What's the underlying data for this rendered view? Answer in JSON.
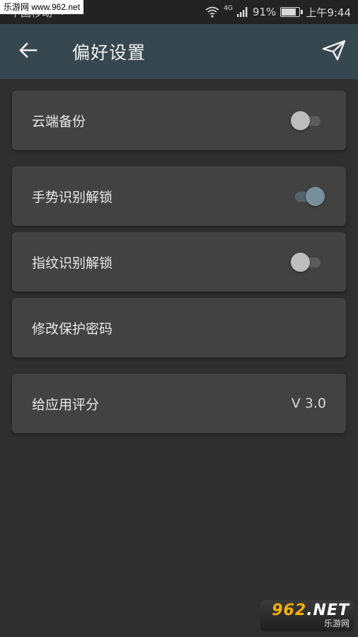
{
  "watermark": {
    "top_text": "乐游网 www.962.net",
    "bottom_number": "962",
    "bottom_suffix": ".NET",
    "bottom_subtitle": "乐游网"
  },
  "status_bar": {
    "carrier": "中国移动",
    "network_type": "4G",
    "battery_percent": "91%",
    "battery_level": 0.91,
    "time": "上午9:44"
  },
  "app_bar": {
    "title": "偏好设置",
    "back_icon": "arrow-left-icon",
    "send_icon": "send-icon"
  },
  "settings": {
    "cloud_backup": {
      "label": "云端备份",
      "enabled": false
    },
    "gesture_unlock": {
      "label": "手势识别解锁",
      "enabled": true
    },
    "fingerprint_unlock": {
      "label": "指纹识别解锁",
      "enabled": false
    },
    "change_password": {
      "label": "修改保护密码"
    },
    "rate_app": {
      "label": "给应用评分",
      "version": "V 3.0"
    }
  },
  "colors": {
    "background": "#2f2f2f",
    "app_bar": "#37474f",
    "card": "#424242",
    "switch_on_thumb": "#78909c",
    "switch_off_thumb": "#bdbdbd"
  }
}
